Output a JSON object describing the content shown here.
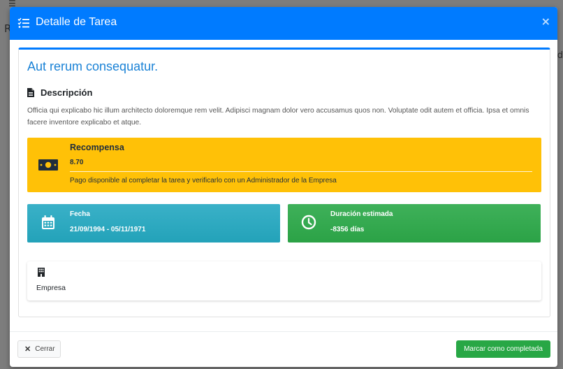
{
  "background": {
    "menu_glyph": "☰",
    "letter_left": "R",
    "letter_right": "d"
  },
  "modal": {
    "title": "Detalle de Tarea",
    "title_icon": "tasks-icon",
    "close_symbol": "×"
  },
  "task": {
    "title": "Aut rerum consequatur.",
    "description_label": "Descripción",
    "description": "Officia qui explicabo hic illum architecto doloremque rem velit. Adipisci magnam dolor vero accusamus quos non. Voluptate odit autem et officia. Ipsa et omnis facere inventore explicabo et atque."
  },
  "reward": {
    "label": "Recompensa",
    "value": "8.70",
    "note": "Pago disponible al completar la tarea y verificarlo con un Administrador de la Empresa",
    "icon": "money-bill-icon"
  },
  "date": {
    "label": "Fecha",
    "value": "21/09/1994 - 05/11/1971",
    "icon": "calendar-icon"
  },
  "duration": {
    "label": "Duración estimada",
    "value": "-8356 días",
    "icon": "clock-icon"
  },
  "company": {
    "label": "Empresa",
    "icon": "building-icon"
  },
  "footer": {
    "close_label": "Cerrar",
    "close_symbol": "✕",
    "complete_label": "Marcar como completada"
  },
  "colors": {
    "primary": "#007bff",
    "warning": "#ffc107",
    "info": "#17a2b8",
    "success": "#28a745"
  }
}
